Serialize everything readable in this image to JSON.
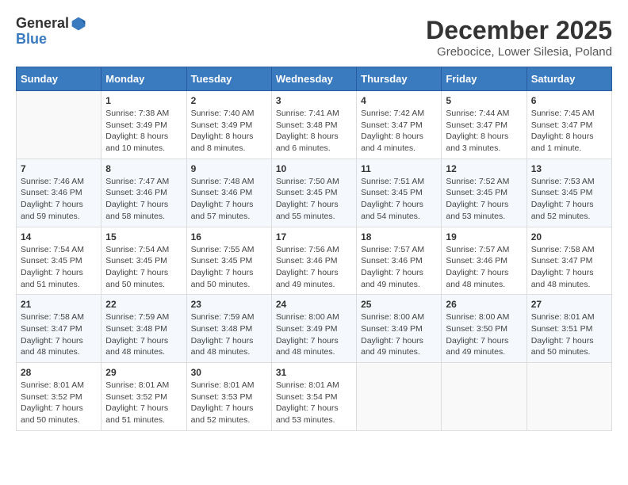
{
  "header": {
    "logo_general": "General",
    "logo_blue": "Blue",
    "month": "December 2025",
    "location": "Grebocice, Lower Silesia, Poland"
  },
  "weekdays": [
    "Sunday",
    "Monday",
    "Tuesday",
    "Wednesday",
    "Thursday",
    "Friday",
    "Saturday"
  ],
  "weeks": [
    [
      {
        "day": "",
        "info": ""
      },
      {
        "day": "1",
        "info": "Sunrise: 7:38 AM\nSunset: 3:49 PM\nDaylight: 8 hours\nand 10 minutes."
      },
      {
        "day": "2",
        "info": "Sunrise: 7:40 AM\nSunset: 3:49 PM\nDaylight: 8 hours\nand 8 minutes."
      },
      {
        "day": "3",
        "info": "Sunrise: 7:41 AM\nSunset: 3:48 PM\nDaylight: 8 hours\nand 6 minutes."
      },
      {
        "day": "4",
        "info": "Sunrise: 7:42 AM\nSunset: 3:47 PM\nDaylight: 8 hours\nand 4 minutes."
      },
      {
        "day": "5",
        "info": "Sunrise: 7:44 AM\nSunset: 3:47 PM\nDaylight: 8 hours\nand 3 minutes."
      },
      {
        "day": "6",
        "info": "Sunrise: 7:45 AM\nSunset: 3:47 PM\nDaylight: 8 hours\nand 1 minute."
      }
    ],
    [
      {
        "day": "7",
        "info": "Sunrise: 7:46 AM\nSunset: 3:46 PM\nDaylight: 7 hours\nand 59 minutes."
      },
      {
        "day": "8",
        "info": "Sunrise: 7:47 AM\nSunset: 3:46 PM\nDaylight: 7 hours\nand 58 minutes."
      },
      {
        "day": "9",
        "info": "Sunrise: 7:48 AM\nSunset: 3:46 PM\nDaylight: 7 hours\nand 57 minutes."
      },
      {
        "day": "10",
        "info": "Sunrise: 7:50 AM\nSunset: 3:45 PM\nDaylight: 7 hours\nand 55 minutes."
      },
      {
        "day": "11",
        "info": "Sunrise: 7:51 AM\nSunset: 3:45 PM\nDaylight: 7 hours\nand 54 minutes."
      },
      {
        "day": "12",
        "info": "Sunrise: 7:52 AM\nSunset: 3:45 PM\nDaylight: 7 hours\nand 53 minutes."
      },
      {
        "day": "13",
        "info": "Sunrise: 7:53 AM\nSunset: 3:45 PM\nDaylight: 7 hours\nand 52 minutes."
      }
    ],
    [
      {
        "day": "14",
        "info": "Sunrise: 7:54 AM\nSunset: 3:45 PM\nDaylight: 7 hours\nand 51 minutes."
      },
      {
        "day": "15",
        "info": "Sunrise: 7:54 AM\nSunset: 3:45 PM\nDaylight: 7 hours\nand 50 minutes."
      },
      {
        "day": "16",
        "info": "Sunrise: 7:55 AM\nSunset: 3:45 PM\nDaylight: 7 hours\nand 50 minutes."
      },
      {
        "day": "17",
        "info": "Sunrise: 7:56 AM\nSunset: 3:46 PM\nDaylight: 7 hours\nand 49 minutes."
      },
      {
        "day": "18",
        "info": "Sunrise: 7:57 AM\nSunset: 3:46 PM\nDaylight: 7 hours\nand 49 minutes."
      },
      {
        "day": "19",
        "info": "Sunrise: 7:57 AM\nSunset: 3:46 PM\nDaylight: 7 hours\nand 48 minutes."
      },
      {
        "day": "20",
        "info": "Sunrise: 7:58 AM\nSunset: 3:47 PM\nDaylight: 7 hours\nand 48 minutes."
      }
    ],
    [
      {
        "day": "21",
        "info": "Sunrise: 7:58 AM\nSunset: 3:47 PM\nDaylight: 7 hours\nand 48 minutes."
      },
      {
        "day": "22",
        "info": "Sunrise: 7:59 AM\nSunset: 3:48 PM\nDaylight: 7 hours\nand 48 minutes."
      },
      {
        "day": "23",
        "info": "Sunrise: 7:59 AM\nSunset: 3:48 PM\nDaylight: 7 hours\nand 48 minutes."
      },
      {
        "day": "24",
        "info": "Sunrise: 8:00 AM\nSunset: 3:49 PM\nDaylight: 7 hours\nand 48 minutes."
      },
      {
        "day": "25",
        "info": "Sunrise: 8:00 AM\nSunset: 3:49 PM\nDaylight: 7 hours\nand 49 minutes."
      },
      {
        "day": "26",
        "info": "Sunrise: 8:00 AM\nSunset: 3:50 PM\nDaylight: 7 hours\nand 49 minutes."
      },
      {
        "day": "27",
        "info": "Sunrise: 8:01 AM\nSunset: 3:51 PM\nDaylight: 7 hours\nand 50 minutes."
      }
    ],
    [
      {
        "day": "28",
        "info": "Sunrise: 8:01 AM\nSunset: 3:52 PM\nDaylight: 7 hours\nand 50 minutes."
      },
      {
        "day": "29",
        "info": "Sunrise: 8:01 AM\nSunset: 3:52 PM\nDaylight: 7 hours\nand 51 minutes."
      },
      {
        "day": "30",
        "info": "Sunrise: 8:01 AM\nSunset: 3:53 PM\nDaylight: 7 hours\nand 52 minutes."
      },
      {
        "day": "31",
        "info": "Sunrise: 8:01 AM\nSunset: 3:54 PM\nDaylight: 7 hours\nand 53 minutes."
      },
      {
        "day": "",
        "info": ""
      },
      {
        "day": "",
        "info": ""
      },
      {
        "day": "",
        "info": ""
      }
    ]
  ]
}
